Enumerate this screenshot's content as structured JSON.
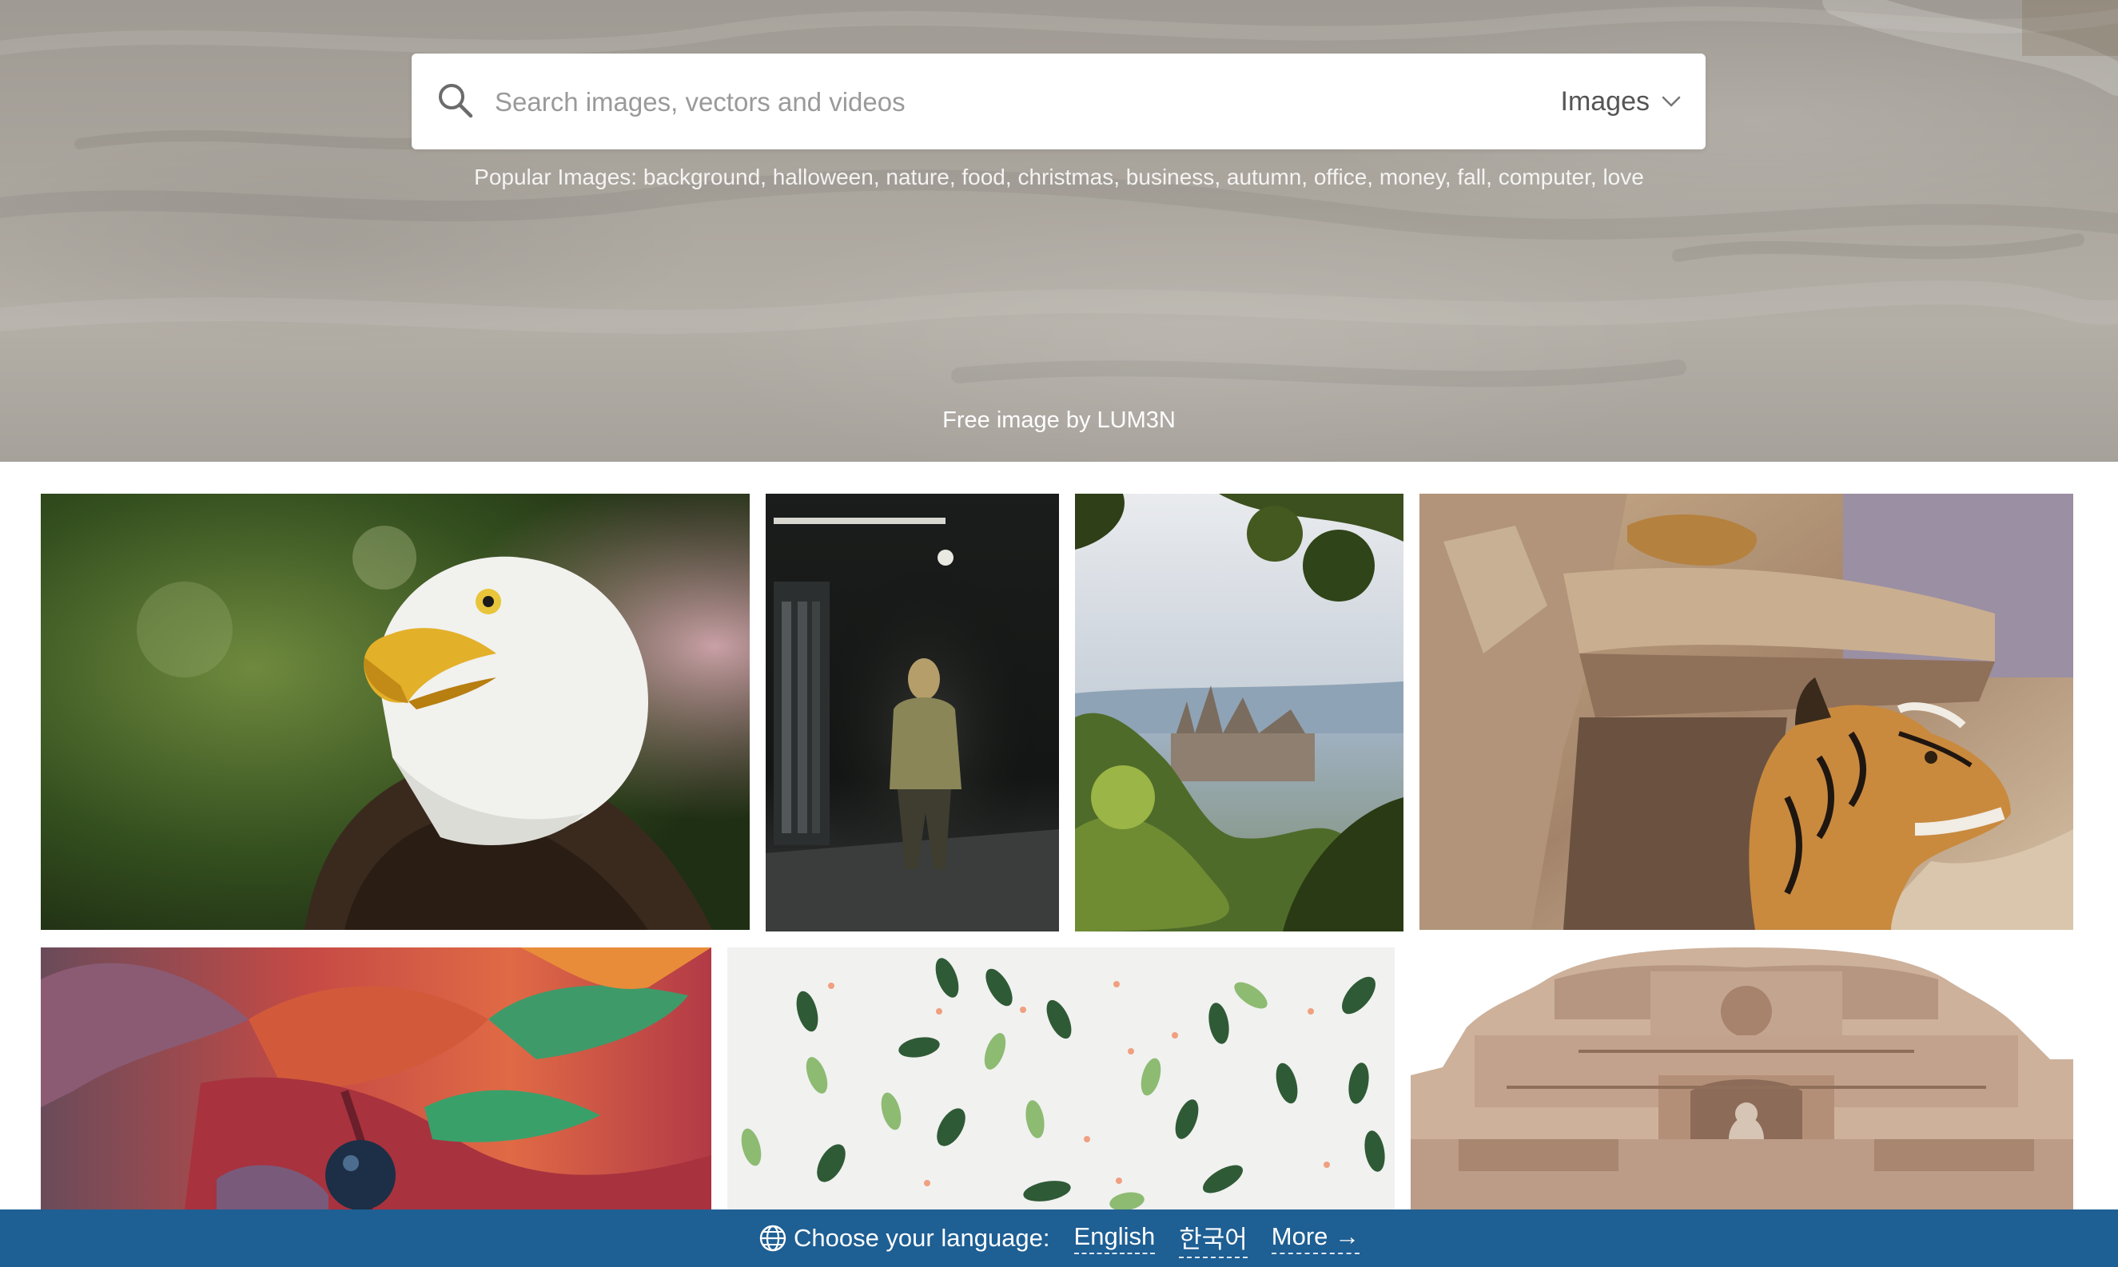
{
  "search": {
    "placeholder": "Search images, vectors and videos",
    "type_selected": "Images"
  },
  "popular": {
    "label": "Popular Images:",
    "tags": [
      "background",
      "halloween",
      "nature",
      "food",
      "christmas",
      "business",
      "autumn",
      "office",
      "money",
      "fall",
      "computer",
      "love"
    ]
  },
  "hero": {
    "credit": "Free image by LUM3N"
  },
  "language_bar": {
    "label": "Choose your language:",
    "options": [
      "English",
      "한국어"
    ],
    "more": "More →"
  },
  "colors": {
    "lang_bar_bg": "#1e5f94",
    "hero_bg": "#a9a49c"
  },
  "icons": [
    "search-icon",
    "chevron-down-icon",
    "globe-icon"
  ]
}
